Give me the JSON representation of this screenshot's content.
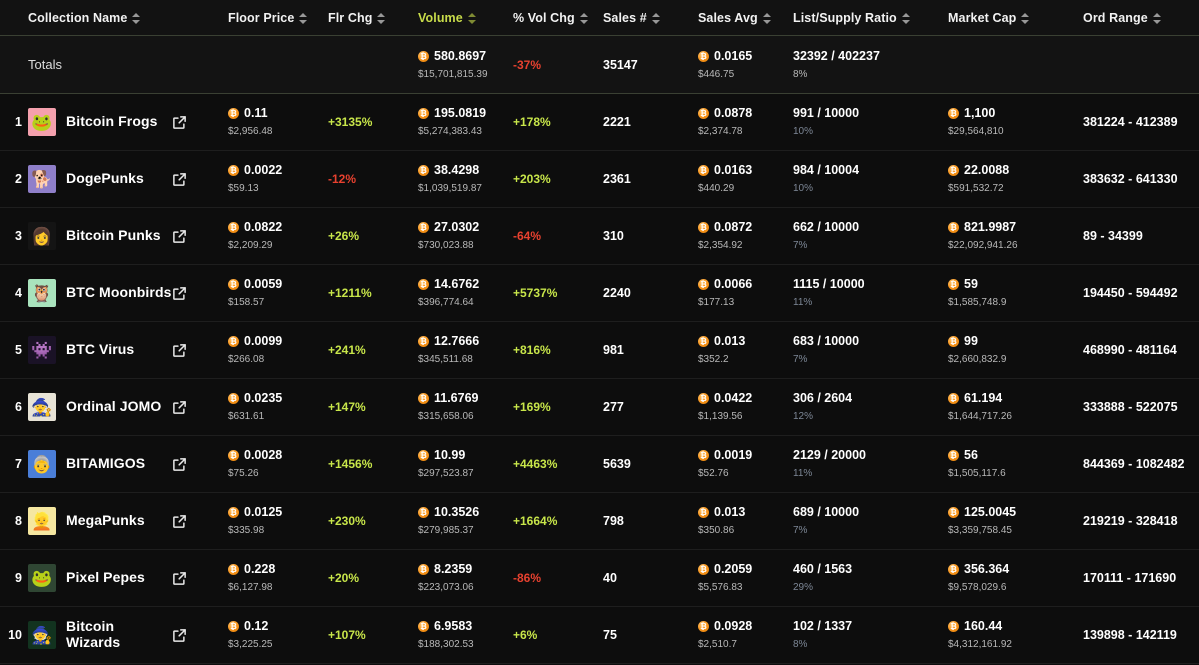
{
  "table": {
    "columns": [
      {
        "key": "rank",
        "label": "",
        "sortable": false,
        "active": false
      },
      {
        "key": "name",
        "label": "Collection Name",
        "sortable": true,
        "active": false
      },
      {
        "key": "link",
        "label": "",
        "sortable": false,
        "active": false
      },
      {
        "key": "floor",
        "label": "Floor Price",
        "sortable": true,
        "active": false
      },
      {
        "key": "flrchg",
        "label": "Flr Chg",
        "sortable": true,
        "active": false
      },
      {
        "key": "volume",
        "label": "Volume",
        "sortable": true,
        "active": true
      },
      {
        "key": "volchg",
        "label": "% Vol Chg",
        "sortable": true,
        "active": false
      },
      {
        "key": "sales",
        "label": "Sales #",
        "sortable": true,
        "active": false
      },
      {
        "key": "salesavg",
        "label": "Sales Avg",
        "sortable": true,
        "active": false
      },
      {
        "key": "listsup",
        "label": "List/Supply Ratio",
        "sortable": true,
        "active": false
      },
      {
        "key": "mcap",
        "label": "Market Cap",
        "sortable": true,
        "active": false
      },
      {
        "key": "ordrange",
        "label": "Ord Range",
        "sortable": true,
        "active": false
      }
    ],
    "totals": {
      "label": "Totals",
      "volume": "580.8697",
      "volume_usd": "$15,701,815.39",
      "vol_chg": "-37%",
      "vol_chg_dir": "down",
      "sales": "35147",
      "sales_avg": "0.0165",
      "sales_avg_usd": "$446.75",
      "list_supply": "32392 / 402237",
      "list_supply_pct": "8%"
    },
    "rows": [
      {
        "rank": "1",
        "name": "Bitcoin Frogs",
        "avatar": {
          "bg": "#f4a0ad",
          "glyph": "🐸"
        },
        "floor": "0.11",
        "floor_usd": "$2,956.48",
        "flr_chg": "+3135%",
        "flr_chg_dir": "up",
        "volume": "195.0819",
        "volume_usd": "$5,274,383.43",
        "vol_chg": "+178%",
        "vol_chg_dir": "up",
        "sales": "2221",
        "sales_avg": "0.0878",
        "sales_avg_usd": "$2,374.78",
        "list_supply": "991 / 10000",
        "list_supply_pct": "10%",
        "mcap": "1,100",
        "mcap_usd": "$29,564,810",
        "ord_range": "381224 - 412389"
      },
      {
        "rank": "2",
        "name": "DogePunks",
        "avatar": {
          "bg": "#8f7fc9",
          "glyph": "🐕"
        },
        "floor": "0.0022",
        "floor_usd": "$59.13",
        "flr_chg": "-12%",
        "flr_chg_dir": "down",
        "volume": "38.4298",
        "volume_usd": "$1,039,519.87",
        "vol_chg": "+203%",
        "vol_chg_dir": "up",
        "sales": "2361",
        "sales_avg": "0.0163",
        "sales_avg_usd": "$440.29",
        "list_supply": "984 / 10004",
        "list_supply_pct": "10%",
        "mcap": "22.0088",
        "mcap_usd": "$591,532.72",
        "ord_range": "383632 - 641330"
      },
      {
        "rank": "3",
        "name": "Bitcoin Punks",
        "avatar": {
          "bg": "#141414",
          "glyph": "👩"
        },
        "floor": "0.0822",
        "floor_usd": "$2,209.29",
        "flr_chg": "+26%",
        "flr_chg_dir": "up",
        "volume": "27.0302",
        "volume_usd": "$730,023.88",
        "vol_chg": "-64%",
        "vol_chg_dir": "down",
        "sales": "310",
        "sales_avg": "0.0872",
        "sales_avg_usd": "$2,354.92",
        "list_supply": "662 / 10000",
        "list_supply_pct": "7%",
        "mcap": "821.9987",
        "mcap_usd": "$22,092,941.26",
        "ord_range": "89 - 34399"
      },
      {
        "rank": "4",
        "name": "BTC Moonbirds",
        "avatar": {
          "bg": "#a9e3bd",
          "glyph": "🦉"
        },
        "floor": "0.0059",
        "floor_usd": "$158.57",
        "flr_chg": "+1211%",
        "flr_chg_dir": "up",
        "volume": "14.6762",
        "volume_usd": "$396,774.64",
        "vol_chg": "+5737%",
        "vol_chg_dir": "up",
        "sales": "2240",
        "sales_avg": "0.0066",
        "sales_avg_usd": "$177.13",
        "list_supply": "1115 / 10000",
        "list_supply_pct": "11%",
        "mcap": "59",
        "mcap_usd": "$1,585,748.9",
        "ord_range": "194450 - 594492"
      },
      {
        "rank": "5",
        "name": "BTC Virus",
        "avatar": {
          "bg": "#1a1226",
          "glyph": "👾"
        },
        "floor": "0.0099",
        "floor_usd": "$266.08",
        "flr_chg": "+241%",
        "flr_chg_dir": "up",
        "volume": "12.7666",
        "volume_usd": "$345,511.68",
        "vol_chg": "+816%",
        "vol_chg_dir": "up",
        "sales": "981",
        "sales_avg": "0.013",
        "sales_avg_usd": "$352.2",
        "list_supply": "683 / 10000",
        "list_supply_pct": "7%",
        "mcap": "99",
        "mcap_usd": "$2,660,832.9",
        "ord_range": "468990 - 481164"
      },
      {
        "rank": "6",
        "name": "Ordinal JOMO",
        "avatar": {
          "bg": "#e7e3d6",
          "glyph": "🧙"
        },
        "floor": "0.0235",
        "floor_usd": "$631.61",
        "flr_chg": "+147%",
        "flr_chg_dir": "up",
        "volume": "11.6769",
        "volume_usd": "$315,658.06",
        "vol_chg": "+169%",
        "vol_chg_dir": "up",
        "sales": "277",
        "sales_avg": "0.0422",
        "sales_avg_usd": "$1,139.56",
        "list_supply": "306 / 2604",
        "list_supply_pct": "12%",
        "mcap": "61.194",
        "mcap_usd": "$1,644,717.26",
        "ord_range": "333888 - 522075"
      },
      {
        "rank": "7",
        "name": "BITAMIGOS",
        "avatar": {
          "bg": "#4a7ed8",
          "glyph": "👵"
        },
        "floor": "0.0028",
        "floor_usd": "$75.26",
        "flr_chg": "+1456%",
        "flr_chg_dir": "up",
        "volume": "10.99",
        "volume_usd": "$297,523.87",
        "vol_chg": "+4463%",
        "vol_chg_dir": "up",
        "sales": "5639",
        "sales_avg": "0.0019",
        "sales_avg_usd": "$52.76",
        "list_supply": "2129 / 20000",
        "list_supply_pct": "11%",
        "mcap": "56",
        "mcap_usd": "$1,505,117.6",
        "ord_range": "844369 - 1082482"
      },
      {
        "rank": "8",
        "name": "MegaPunks",
        "avatar": {
          "bg": "#f5e7a0",
          "glyph": "👱"
        },
        "floor": "0.0125",
        "floor_usd": "$335.98",
        "flr_chg": "+230%",
        "flr_chg_dir": "up",
        "volume": "10.3526",
        "volume_usd": "$279,985.37",
        "vol_chg": "+1664%",
        "vol_chg_dir": "up",
        "sales": "798",
        "sales_avg": "0.013",
        "sales_avg_usd": "$350.86",
        "list_supply": "689 / 10000",
        "list_supply_pct": "7%",
        "mcap": "125.0045",
        "mcap_usd": "$3,359,758.45",
        "ord_range": "219219 - 328418"
      },
      {
        "rank": "9",
        "name": "Pixel Pepes",
        "avatar": {
          "bg": "#2f4633",
          "glyph": "🐸"
        },
        "floor": "0.228",
        "floor_usd": "$6,127.98",
        "flr_chg": "+20%",
        "flr_chg_dir": "up",
        "volume": "8.2359",
        "volume_usd": "$223,073.06",
        "vol_chg": "-86%",
        "vol_chg_dir": "down",
        "sales": "40",
        "sales_avg": "0.2059",
        "sales_avg_usd": "$5,576.83",
        "list_supply": "460 / 1563",
        "list_supply_pct": "29%",
        "mcap": "356.364",
        "mcap_usd": "$9,578,029.6",
        "ord_range": "170111 - 171690"
      },
      {
        "rank": "10",
        "name": "Bitcoin Wizards",
        "avatar": {
          "bg": "#12331f",
          "glyph": "🧙"
        },
        "floor": "0.12",
        "floor_usd": "$3,225.25",
        "flr_chg": "+107%",
        "flr_chg_dir": "up",
        "volume": "6.9583",
        "volume_usd": "$188,302.53",
        "vol_chg": "+6%",
        "vol_chg_dir": "up",
        "sales": "75",
        "sales_avg": "0.0928",
        "sales_avg_usd": "$2,510.7",
        "list_supply": "102 / 1337",
        "list_supply_pct": "8%",
        "mcap": "160.44",
        "mcap_usd": "$4,312,161.92",
        "ord_range": "139898 - 142119"
      }
    ]
  },
  "colors": {
    "accent_active": "#c8dc4a",
    "up": "#c8e64a",
    "down": "#e8412f",
    "bitcoin": "#f7931a",
    "muted_pct": "#7d8796"
  }
}
